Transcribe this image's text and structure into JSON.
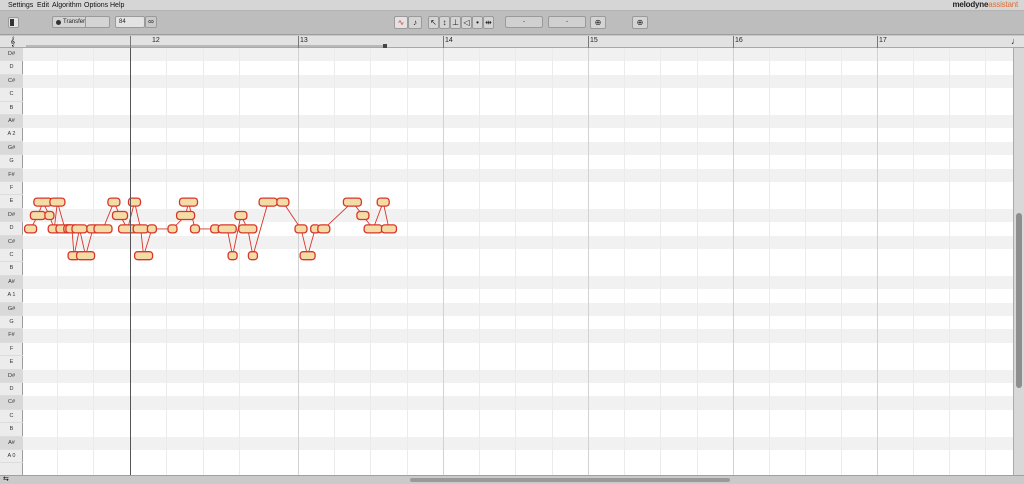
{
  "menu": {
    "items": [
      "Settings",
      "Edit",
      "Algorithm",
      "Options",
      "Help"
    ],
    "brand": "melodyne",
    "edition": "assistant"
  },
  "toolbar": {
    "transfer_label": "Transfer",
    "tempo_value": "84",
    "field_a": "-",
    "field_b": "-",
    "icons": [
      "sidebar-toggle",
      "record-dot",
      "link",
      "pitch-tool",
      "note-tool",
      "pointer-tool",
      "pitch-drift-tool",
      "formant-tool",
      "amplitude-tool",
      "time-tool",
      "separation-tool",
      "quantize-macro",
      "pitch-macro"
    ]
  },
  "ruler": {
    "bars": [
      "12",
      "13",
      "14",
      "15",
      "16",
      "17"
    ]
  },
  "keyboard": {
    "notes": [
      "D#",
      "D",
      "C#",
      "C",
      "B",
      "A#",
      "A 2",
      "G#",
      "G",
      "F#",
      "F",
      "E",
      "D#",
      "D",
      "C#",
      "C",
      "B",
      "A#",
      "A 1",
      "G#",
      "G",
      "F#",
      "F",
      "E",
      "D#",
      "D",
      "C#",
      "C",
      "B",
      "A#",
      "A 0"
    ]
  },
  "notes": [
    {
      "time": 0.1,
      "pitch": "D"
    },
    {
      "time": 0.3,
      "pitch": "D#"
    },
    {
      "time": 0.44,
      "pitch": "E"
    },
    {
      "time": 0.62,
      "pitch": "D#"
    },
    {
      "time": 0.75,
      "pitch": "D"
    },
    {
      "time": 0.84,
      "pitch": "E"
    },
    {
      "time": 1.05,
      "pitch": "D"
    },
    {
      "time": 1.14,
      "pitch": "D"
    },
    {
      "time": 1.24,
      "pitch": "D"
    },
    {
      "time": 1.3,
      "pitch": "C"
    },
    {
      "time": 1.45,
      "pitch": "D"
    },
    {
      "time": 1.62,
      "pitch": "C"
    },
    {
      "time": 1.82,
      "pitch": "C#"
    },
    {
      "time": 2.1,
      "pitch": "D"
    },
    {
      "time": 2.4,
      "pitch": "E"
    },
    {
      "time": 2.57,
      "pitch": "D#"
    },
    {
      "time": 2.78,
      "pitch": "D"
    },
    {
      "time": 2.97,
      "pitch": "E"
    },
    {
      "time": 3.14,
      "pitch": "D"
    },
    {
      "time": 3.22,
      "pitch": "C"
    },
    {
      "time": 3.45,
      "pitch": "D"
    },
    {
      "time": 4.02,
      "pitch": "D"
    },
    {
      "time": 4.38,
      "pitch": "D#"
    },
    {
      "time": 4.46,
      "pitch": "E"
    },
    {
      "time": 4.64,
      "pitch": "D"
    },
    {
      "time": 5.2,
      "pitch": "D"
    },
    {
      "time": 5.53,
      "pitch": "D"
    },
    {
      "time": 5.68,
      "pitch": "C"
    },
    {
      "time": 5.91,
      "pitch": "D#"
    },
    {
      "time": 6.1,
      "pitch": "D"
    },
    {
      "time": 6.24,
      "pitch": "C"
    },
    {
      "time": 6.66,
      "pitch": "E"
    },
    {
      "time": 7.07,
      "pitch": "E"
    },
    {
      "time": 7.57,
      "pitch": "D"
    },
    {
      "time": 7.75,
      "pitch": "C"
    },
    {
      "time": 7.96,
      "pitch": "D"
    },
    {
      "time": 8.2,
      "pitch": "D"
    },
    {
      "time": 8.99,
      "pitch": "E"
    },
    {
      "time": 9.28,
      "pitch": "D#"
    },
    {
      "time": 9.56,
      "pitch": "D"
    },
    {
      "time": 9.84,
      "pitch": "E"
    },
    {
      "time": 10.0,
      "pitch": "D"
    }
  ],
  "colors": {
    "note_outline": "#d9352a",
    "note_fill": "#f3dca6",
    "accent": "#e0703a"
  }
}
